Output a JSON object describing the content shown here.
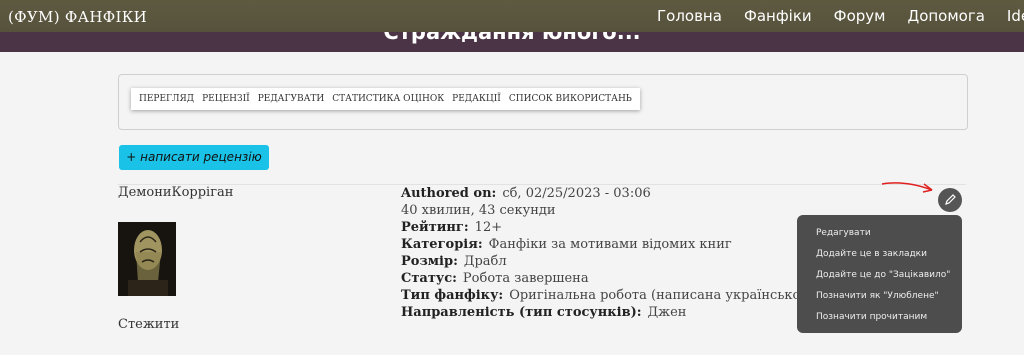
{
  "site": {
    "title": "(ФУМ) ФАНФІКИ"
  },
  "nav": {
    "items": [
      "Головна",
      "Фанфіки",
      "Форум",
      "Допомога",
      "Ide"
    ]
  },
  "page": {
    "title": "Страждання юного..."
  },
  "tabs": [
    "ПЕРЕГЛЯД",
    "РЕЦЕНЗІЇ",
    "РЕДАГУВАТИ",
    "СТАТИСТИКА ОЦІНОК",
    "РЕДАКЦІЇ",
    "СПИСОК ВИКОРИСТАНЬ"
  ],
  "review_button": "+ написати рецензію",
  "author": {
    "name": "ДемониКорріган",
    "follow": "Стежити"
  },
  "meta": [
    {
      "label": "Authored on:",
      "value": "сб, 02/25/2023 - 03:06"
    },
    {
      "label": "",
      "value": "40 хвилин, 43 секунди"
    },
    {
      "label": "Рейтинг:",
      "value": "12+"
    },
    {
      "label": "Категорія:",
      "value": "Фанфіки за мотивами відомих книг"
    },
    {
      "label": "Розмір:",
      "value": "Драбл"
    },
    {
      "label": "Статус:",
      "value": "Робота завершена"
    },
    {
      "label": "Тип фанфіку:",
      "value": "Оригінальна робота (написана українською)"
    },
    {
      "label": "Направленість (тип стосунків):",
      "value": "Джен"
    }
  ],
  "icons": {
    "edit": "pencil-icon",
    "annotation": "red-arrow-icon"
  },
  "colors": {
    "topbar": "#5b5640",
    "band": "#4a3446",
    "button": "#19c2e6",
    "menu": "#4d4d4d",
    "arrow": "#e02020"
  },
  "context_menu": [
    "Редагувати",
    "Додайте це в закладки",
    "Додайте це до \"Зацікавило\"",
    "Позначити як \"Улюблене\"",
    "Позначити прочитаним"
  ]
}
